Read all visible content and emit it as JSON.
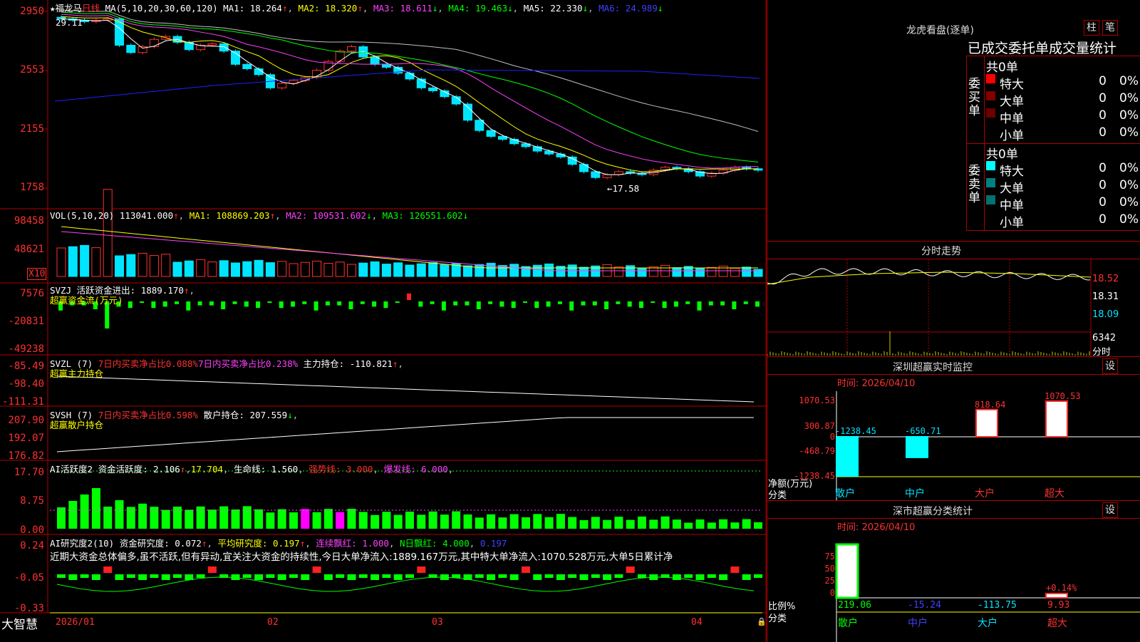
{
  "colors": {
    "up": "#ff3030",
    "down": "#00e5ff",
    "ma1": "#ffffff",
    "ma2": "#ffff00",
    "ma3": "#ff40ff",
    "ma4": "#00ff00",
    "ma5": "#c0c0c0",
    "ma6": "#2020ff",
    "grid": "#b00000"
  },
  "kline": {
    "title": "★福龙马",
    "period": "日线",
    "ma_name": "MA(5,10,20,30,60,120)",
    "ma": [
      {
        "label": "MA1: 18.264",
        "arrow": "↑"
      },
      {
        "label": "MA2: 18.320",
        "arrow": "↑"
      },
      {
        "label": "MA3: 18.611",
        "arrow": "↓"
      },
      {
        "label": "MA4: 19.463",
        "arrow": "↓"
      },
      {
        "label": "MA5: 22.330",
        "arrow": "↓"
      },
      {
        "label": "MA6: 24.989",
        "arrow": "↓"
      }
    ],
    "yticks": [
      "2950",
      "2553",
      "2155",
      "1758"
    ],
    "high_mark": "29.11",
    "low_mark": "←17.58",
    "closes": [
      29.0,
      28.9,
      28.8,
      28.9,
      29.0,
      27.2,
      26.7,
      27.1,
      27.6,
      27.8,
      27.4,
      26.9,
      27.2,
      27.3,
      26.8,
      25.9,
      25.6,
      25.2,
      24.3,
      24.6,
      24.8,
      25.0,
      25.5,
      26.1,
      26.8,
      27.1,
      26.4,
      25.9,
      25.7,
      25.3,
      24.9,
      24.3,
      24.1,
      23.7,
      23.2,
      22.1,
      21.4,
      21.0,
      20.8,
      20.5,
      20.3,
      20.0,
      19.8,
      19.6,
      19.1,
      18.6,
      18.2,
      18.4,
      18.6,
      18.5,
      18.4,
      18.7,
      18.9,
      18.8,
      18.6,
      18.3,
      18.5,
      18.7,
      18.9,
      18.8,
      18.7
    ]
  },
  "vol": {
    "name": "VOL(5,10,20)",
    "value": "113041.000",
    "value_arrow": "↑",
    "ma1": "MA1: 108869.203",
    "ma1_arrow": "↑",
    "ma2": "MA2: 109531.602",
    "ma2_arrow": "↓",
    "ma3": "MA3: 126551.602",
    "ma3_arrow": "↓",
    "yticks": [
      "98458",
      "48621"
    ],
    "unit": "X10"
  },
  "svzj": {
    "name": "SVZJ",
    "label": "活跃资金进出: 1889.170",
    "arrow": "↑",
    "sub": "超赢资金流(万元)",
    "yticks": [
      "7576",
      "-20831",
      "-49238"
    ]
  },
  "svzl": {
    "name": "SVZL (7)",
    "t1": "7日内买卖净占比0.088%",
    "t2": "7日内买卖净占比0.238%",
    "t3": "主力持仓: -110.821",
    "t3_arrow": "↑",
    "sub": "超赢主力持仓",
    "yticks": [
      "-85.49",
      "-98.40",
      "-111.31"
    ]
  },
  "svsh": {
    "name": "SVSH (7)",
    "t1": "7日内买卖净占比0.598%",
    "t2": "散户持仓: 207.559",
    "t2_arrow": "↓",
    "sub": "超赢散户持仓",
    "yticks": [
      "207.90",
      "192.07",
      "176.82"
    ]
  },
  "ai1": {
    "name": "AI活跃度2",
    "t1": "资金活跃度: 2.106",
    "t1_arrow": "↑",
    "t2": "17.704",
    "t3": "生命线: 1.560",
    "t4": "强势线: 3.000",
    "t5": "爆发线: 6.000",
    "yticks": [
      "17.70",
      "8.75",
      "0.00"
    ]
  },
  "ai2": {
    "name": "AI研究度2(10)",
    "t1": "资金研究度: 0.072",
    "t2": "平均研究度: 0.197",
    "t3": "连续飘红: 1.000",
    "t4": "N日飘红: 4.000",
    "t5": "0.197",
    "yticks": [
      "0.24",
      "-0.05",
      "-0.33"
    ],
    "comment": "近期大资金总体偏多,虽不活跃,但有异动,宜关注大资金的持续性,今日大单净流入:1889.167万元,其中特大单净流入:1070.528万元,大单5日累计净"
  },
  "xaxis": {
    "brand": "大智慧",
    "labels": [
      "2026/01",
      "02",
      "03",
      "04"
    ]
  },
  "lhb": {
    "title": "龙虎看盘(逐单)",
    "btn1": "柱",
    "btn2": "笔",
    "heading": "已成交委托单成交量统计",
    "buy": {
      "side": "委买单",
      "total": "共0单",
      "rows": [
        {
          "name": "特大",
          "count": "0",
          "pct": "0%",
          "color": "#ff0000"
        },
        {
          "name": "大单",
          "count": "0",
          "pct": "0%",
          "color": "#800000"
        },
        {
          "name": "中单",
          "count": "0",
          "pct": "0%",
          "color": "#6a0000"
        },
        {
          "name": "小单",
          "count": "0",
          "pct": "0%",
          "color": ""
        }
      ]
    },
    "sell": {
      "side": "委卖单",
      "total": "共0单",
      "rows": [
        {
          "name": "特大",
          "count": "0",
          "pct": "0%",
          "color": "#00ffff"
        },
        {
          "name": "大单",
          "count": "0",
          "pct": "0%",
          "color": "#008080"
        },
        {
          "name": "中单",
          "count": "0",
          "pct": "0%",
          "color": "#007070"
        },
        {
          "name": "小单",
          "count": "0",
          "pct": "0%",
          "color": ""
        }
      ]
    }
  },
  "fenshi": {
    "title": "分时走势",
    "yticks": [
      "18.52",
      "18.31",
      "18.09"
    ],
    "vol_tick": "6342",
    "vol_label": "分时"
  },
  "monitor": {
    "title": "深圳超赢实时监控",
    "btn": "设",
    "date": "时间: 2026/04/10",
    "yticks": [
      "1070.53",
      "300.87",
      "0",
      "-468.79",
      "-1238.45"
    ],
    "ylabel": "净额(万元)",
    "xlabel": "分类",
    "cats": [
      "散户",
      "中户",
      "大户",
      "超大"
    ],
    "values": [
      -1238.45,
      -650.71,
      818.64,
      1070.53
    ],
    "value_labels": [
      "-1238.45",
      "-650.71",
      "818.64",
      "1070.53"
    ]
  },
  "classify": {
    "title": "深市超赢分类统计",
    "btn": "设",
    "date": "时间: 2026/04/10",
    "yticks": [
      "75",
      "50",
      "25",
      "0"
    ],
    "ylabel": "比例%",
    "xlabel": "分类",
    "cats": [
      "散户",
      "中户",
      "大户",
      "超大"
    ],
    "values": [
      "219.06",
      "-15.24",
      "-113.75",
      "9.93"
    ],
    "annot": "+0.14%"
  }
}
